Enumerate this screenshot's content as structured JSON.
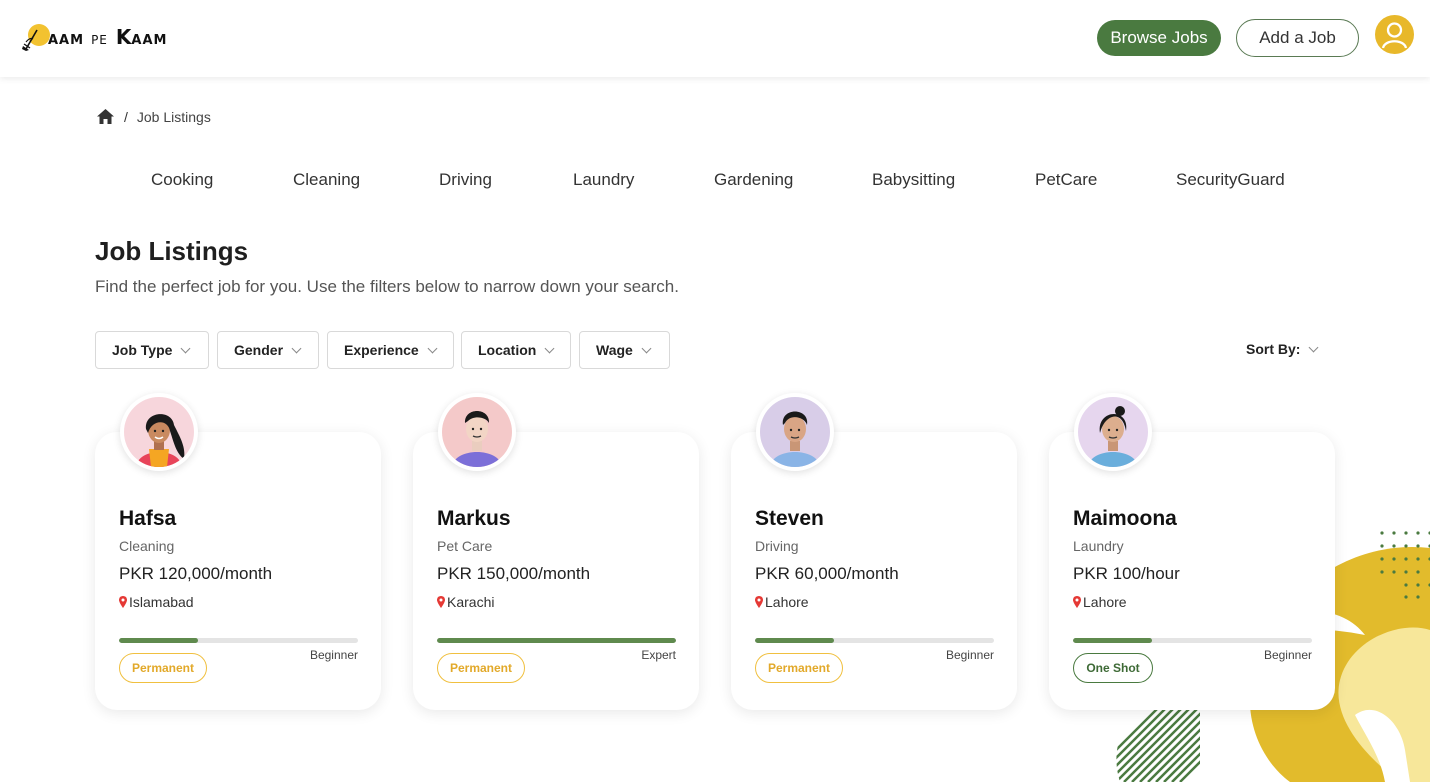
{
  "header": {
    "logo": {
      "a": "AAM",
      "pe": "PE",
      "k": "K",
      "b": "AAM"
    },
    "browse_label": "Browse Jobs",
    "add_label": "Add a Job"
  },
  "breadcrumb": {
    "sep": "/",
    "current": "Job Listings"
  },
  "categories": [
    "Cooking",
    "Cleaning",
    "Driving",
    "Laundry",
    "Gardening",
    "Babysitting",
    "PetCare",
    "SecurityGuard"
  ],
  "page": {
    "title": "Job Listings",
    "subtitle": "Find the perfect job for you. Use the filters below to narrow down your search."
  },
  "filters": [
    "Job Type",
    "Gender",
    "Experience",
    "Location",
    "Wage"
  ],
  "sort_label": "Sort By:",
  "colors": {
    "primary": "#4a7a40",
    "accent": "#e8b82a",
    "badge_perm": "#e2a92a"
  },
  "cards": [
    {
      "name": "Hafsa",
      "type": "Cleaning",
      "wage": "PKR 120,000/month",
      "location": "Islamabad",
      "level": "Beginner",
      "progress": 0.33,
      "badge": "Permanent",
      "avatar_icon": "woman-avatar-icon"
    },
    {
      "name": "Markus",
      "type": "Pet Care",
      "wage": "PKR 150,000/month",
      "location": "Karachi",
      "level": "Expert",
      "progress": 1.0,
      "badge": "Permanent",
      "avatar_icon": "man-avatar-icon"
    },
    {
      "name": "Steven",
      "type": "Driving",
      "wage": "PKR 60,000/month",
      "location": "Lahore",
      "level": "Beginner",
      "progress": 0.33,
      "badge": "Permanent",
      "avatar_icon": "man-avatar-icon"
    },
    {
      "name": "Maimoona",
      "type": "Laundry",
      "wage": "PKR 100/hour",
      "location": "Lahore",
      "level": "Beginner",
      "progress": 0.33,
      "badge": "One Shot",
      "avatar_icon": "woman-avatar-icon"
    }
  ]
}
